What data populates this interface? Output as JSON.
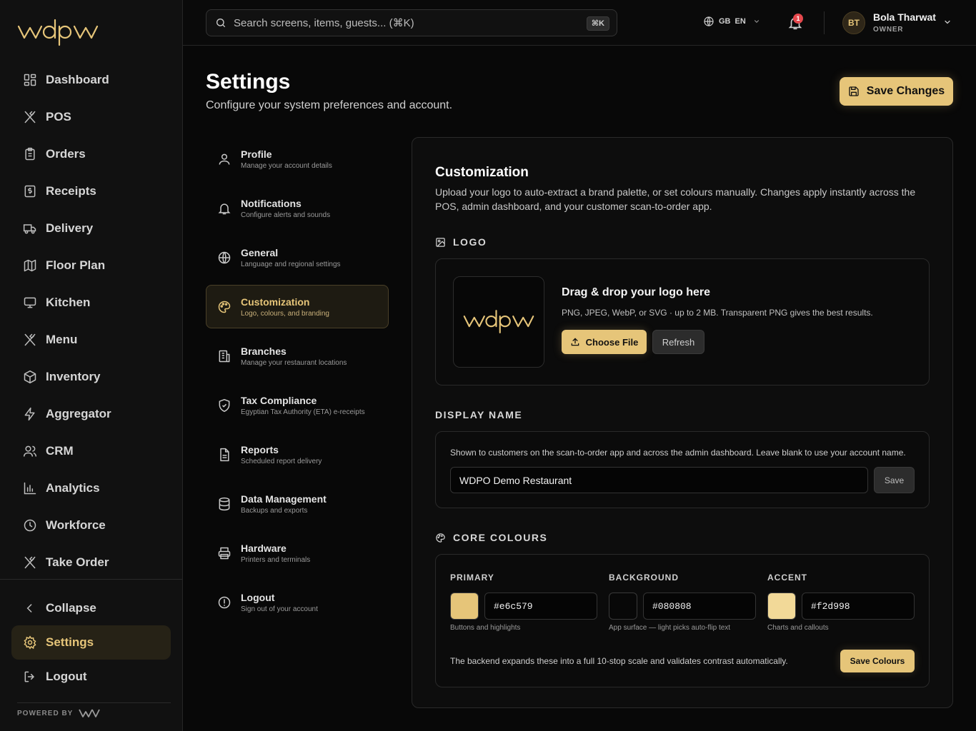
{
  "brand": {
    "logo_text": "wdpw",
    "powered_by": "POWERED BY",
    "accent": "#e6c579"
  },
  "sidebar": {
    "items": [
      {
        "label": "Dashboard",
        "icon": "dashboard-icon"
      },
      {
        "label": "POS",
        "icon": "utensils-icon"
      },
      {
        "label": "Orders",
        "icon": "clipboard-icon"
      },
      {
        "label": "Receipts",
        "icon": "receipt-icon"
      },
      {
        "label": "Delivery",
        "icon": "truck-icon"
      },
      {
        "label": "Floor Plan",
        "icon": "map-icon"
      },
      {
        "label": "Kitchen",
        "icon": "monitor-icon"
      },
      {
        "label": "Menu",
        "icon": "utensils-icon"
      },
      {
        "label": "Inventory",
        "icon": "box-icon"
      },
      {
        "label": "Aggregator",
        "icon": "bolt-icon"
      },
      {
        "label": "CRM",
        "icon": "users-icon"
      },
      {
        "label": "Analytics",
        "icon": "bar-chart-icon"
      },
      {
        "label": "Workforce",
        "icon": "clock-icon"
      },
      {
        "label": "Take Order",
        "icon": "utensils-icon"
      }
    ],
    "collapse": "Collapse",
    "settings": "Settings",
    "logout": "Logout"
  },
  "topbar": {
    "search_placeholder": "Search screens, items, guests... (⌘K)",
    "shortcut": "⌘K",
    "lang_region": "GB",
    "lang_code": "EN",
    "notifications_count": "1",
    "user": {
      "initials": "BT",
      "name": "Bola Tharwat",
      "role": "OWNER"
    }
  },
  "header": {
    "title": "Settings",
    "subtitle": "Configure your system preferences and account.",
    "save_label": "Save Changes"
  },
  "settings_menu": [
    {
      "title": "Profile",
      "desc": "Manage your account details",
      "icon": "user-icon"
    },
    {
      "title": "Notifications",
      "desc": "Configure alerts and sounds",
      "icon": "bell-icon"
    },
    {
      "title": "General",
      "desc": "Language and regional settings",
      "icon": "globe-icon"
    },
    {
      "title": "Customization",
      "desc": "Logo, colours, and branding",
      "icon": "palette-icon"
    },
    {
      "title": "Branches",
      "desc": "Manage your restaurant locations",
      "icon": "building-icon"
    },
    {
      "title": "Tax Compliance",
      "desc": "Egyptian Tax Authority (ETA) e-receipts",
      "icon": "shield-check-icon"
    },
    {
      "title": "Reports",
      "desc": "Scheduled report delivery",
      "icon": "file-text-icon"
    },
    {
      "title": "Data Management",
      "desc": "Backups and exports",
      "icon": "database-icon"
    },
    {
      "title": "Hardware",
      "desc": "Printers and terminals",
      "icon": "printer-icon"
    },
    {
      "title": "Logout",
      "desc": "Sign out of your account",
      "icon": "alert-circle-icon"
    }
  ],
  "customization": {
    "title": "Customization",
    "description": "Upload your logo to auto-extract a brand palette, or set colours manually. Changes apply instantly across the POS, admin dashboard, and your customer scan-to-order app.",
    "logo_section": {
      "label": "LOGO",
      "drop_title": "Drag & drop your logo here",
      "drop_hint": "PNG, JPEG, WebP, or SVG · up to 2 MB. Transparent PNG gives the best results.",
      "choose_label": "Choose File",
      "refresh_label": "Refresh"
    },
    "display_name": {
      "label": "DISPLAY NAME",
      "help": "Shown to customers on the scan-to-order app and across the admin dashboard. Leave blank to use your account name.",
      "value": "WDPO Demo Restaurant",
      "save_label": "Save"
    },
    "core_colours": {
      "label": "CORE COLOURS",
      "primary": {
        "label": "PRIMARY",
        "hex": "#e6c579",
        "help": "Buttons and highlights"
      },
      "background": {
        "label": "BACKGROUND",
        "hex": "#080808",
        "help": "App surface — light picks auto-flip text"
      },
      "accent": {
        "label": "ACCENT",
        "hex": "#f2d998",
        "help": "Charts and callouts"
      },
      "note": "The backend expands these into a full 10-stop scale and validates contrast automatically.",
      "save_label": "Save Colours"
    }
  }
}
